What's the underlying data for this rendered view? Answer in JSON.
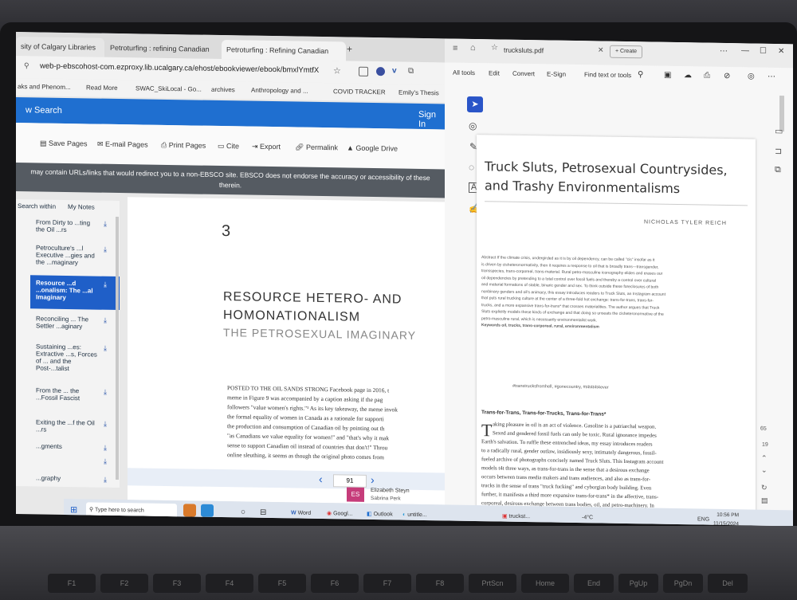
{
  "left_browser": {
    "tabs": [
      {
        "label": "sity of Calgary Libraries"
      },
      {
        "label": "Petroturfing : refining Canadian"
      },
      {
        "label": "Petroturfing : Refining Canadian"
      }
    ],
    "address": "web-p-ebscohost-com.ezproxy.lib.ucalgary.ca/ehost/ebookviewer/ebook/bmxlYmtfX",
    "bookmarks": [
      "aks and Phenom...",
      "Read More",
      "SWAC_SkiLocal - Go...",
      "archives",
      "Anthropology and ...",
      "COVID TRACKER",
      "Emily's Thesis"
    ],
    "search_label": "w Search",
    "sign_in": "Sign In",
    "tools": [
      "Save Pages",
      "E-mail Pages",
      "Print Pages",
      "Cite",
      "Export",
      "Permalink",
      "Google Drive"
    ],
    "notice": "may contain URLs/links that would redirect you to a non-EBSCO site. EBSCO does not endorse the accuracy or accessibility of these",
    "notice2": "therein.",
    "search_within": "Search within",
    "my_notes": "My Notes",
    "toc": [
      "From Dirty to ...ting the Oil ...rs",
      "Petroculture's ...l Executive ...gies and the ...maginary",
      "Resource ...d ...onalism: The ...al Imaginary",
      "Reconciling ... The Settler ...aginary",
      "Sustaining ...es: Extractive ...s, Forces of ... and the Post-...talist",
      "From the ... the ...Fossil Fascist",
      "Exiting the ...f the Oil ...rs",
      "...gments",
      "...graphy"
    ],
    "chapter_number": "3",
    "chapter_title_1": "RESOURCE HETERO- AND",
    "chapter_title_2": "HOMONATIONALISM",
    "chapter_subtitle": "THE PETROSEXUAL IMAGINARY",
    "body_lines": [
      "POSTED TO THE OIL SANDS STRONG Facebook page in 2016, t",
      "meme in Figure 9 was accompanied by a caption asking if the pag",
      "followers \"value women's rights.\"¹ As its key takeaway, the meme invok",
      "the formal equality of women in Canada as a rationale for supporti",
      "the production and consumption of Canadian oil by pointing out th",
      "\"as Canadians we value equality for women!\" and \"that's why it mak",
      "sense to support Canadian oil instead of countries that don't!\" Throu",
      "online sleuthing, it seems as though the original photo comes from"
    ],
    "page_number": "91",
    "chat_name": "Elizabeth Steyn",
    "chat_to": "Sabrina Perk",
    "chat_initials": "ES"
  },
  "pdf": {
    "tab_title": "trucksluts.pdf",
    "create": "Create",
    "menu": [
      "All tools",
      "Edit",
      "Convert",
      "E-Sign"
    ],
    "find": "Find text or tools",
    "title_line1": "Truck Sluts, Petrosexual Countrysides,",
    "title_line2": "and Trashy Environmentalisms",
    "author": "NICHOLAS TYLER REICH",
    "abstract_lines": [
      "Abstract  If the climate crisis, undergirded as it is by oil dependency, can be called \"cis\" insofar as it",
      "is driven by cisheteronormativity, then it requires a response to oil that is broadly trans—transgender,",
      "transspecies, trans-corporeal, trans-material. Rural petro-masculine iconography elides and erases our",
      "oil dependencies by pretending to a total control over fossil fuels and thereby a control over cultural",
      "and material formations of stable, binaric gender and sex. To think outside these foreclosures of both",
      "nonbinary genders and oil's animacy, this essay introduces readers to Truck Sluts, an Instagram account",
      "that puts rural trucking culture at the center of a three-fold hot exchange: trans-for-trans, trans-for-",
      "trucks, and a more expansive trans-for-trans* that crosses materialities. The author argues that Truck",
      "Sluts explicitly models these kinds of exchange and that doing so unseats the cisheteronormative of the",
      "petro-masculine rural, which is necessarily environmentalist work."
    ],
    "keywords": "Keywords  oil, trucks, trans-corporeal, rural, environmentalism",
    "hashtags": "#transtrucksfromhell, #gonecountry, #t4t4t4t4ever",
    "section_heading": "Trans-for-Trans, Trans-for-Trucks, Trans-for-Trans*",
    "body_lines": [
      "aking pleasure in oil is an act of violence. Gasoline is a patriarchal weapon.",
      "Sexed and gendered fossil fuels can only be toxic. Rural ignorance impedes",
      "Earth's salvation. To ruffle these entrenched ideas, my essay introduces readers",
      "to a radically rural, gender outlaw, insidiously sexy, intimately dangerous, fossil-",
      "fueled archive of photographs concisely named Truck Sluts. This Instagram account",
      "models t4t three ways, as trans-for-trans in the sense that a desirous exchange",
      "occurs between trans media makers and trans audiences, and also as trans-for-",
      "trucks in the sense of trans \"truck fucking\" and cyborgian body building. Even",
      "further, it manifests a third more expansive trans-for-trans* in the affective, trans-",
      "corporeal, desirous exchange between trans bodies, oil, and petro-machinery. In"
    ],
    "drop_cap": "T",
    "page_counter_top": "65",
    "page_counter_bottom": "19"
  },
  "taskbar": {
    "search": "Type here to search",
    "apps": [
      "Word",
      "Googl...",
      "Outlook",
      "untitle...",
      "truckst..."
    ],
    "temp": "-4°C",
    "lang": "ENG",
    "time": "10:56 PM",
    "date": "11/15/2024"
  },
  "keyboard": [
    "F1",
    "F2",
    "F3",
    "F4",
    "F5",
    "F6",
    "F7",
    "F8",
    "PrtScn",
    "Home",
    "End",
    "PgUp",
    "PgDn",
    "Del"
  ]
}
